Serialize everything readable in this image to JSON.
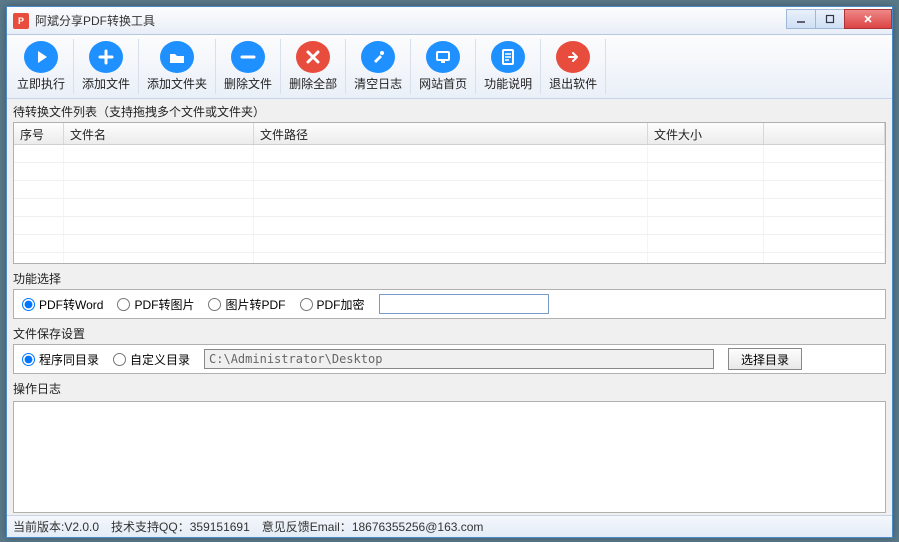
{
  "window": {
    "title": "阿斌分享PDF转换工具"
  },
  "toolbar": [
    {
      "id": "run",
      "label": "立即执行",
      "color": "#1e90ff",
      "icon": "play"
    },
    {
      "id": "add-file",
      "label": "添加文件",
      "color": "#1e90ff",
      "icon": "plus"
    },
    {
      "id": "add-folder",
      "label": "添加文件夹",
      "color": "#1e90ff",
      "icon": "folder"
    },
    {
      "id": "remove-file",
      "label": "删除文件",
      "color": "#1e90ff",
      "icon": "minus"
    },
    {
      "id": "remove-all",
      "label": "删除全部",
      "color": "#e74c3c",
      "icon": "x"
    },
    {
      "id": "clear-log",
      "label": "清空日志",
      "color": "#1e90ff",
      "icon": "brush"
    },
    {
      "id": "website",
      "label": "网站首页",
      "color": "#1e90ff",
      "icon": "monitor"
    },
    {
      "id": "help",
      "label": "功能说明",
      "color": "#1e90ff",
      "icon": "doc"
    },
    {
      "id": "exit",
      "label": "退出软件",
      "color": "#e74c3c",
      "icon": "exit"
    }
  ],
  "file_list": {
    "group_label": "待转换文件列表（支持拖拽多个文件或文件夹）",
    "columns": {
      "index": "序号",
      "name": "文件名",
      "path": "文件路径",
      "size": "文件大小"
    },
    "col_widths": {
      "index": 50,
      "name": 190,
      "path": 394,
      "size": 116,
      "tail": 110
    },
    "rows": []
  },
  "function_select": {
    "label": "功能选择",
    "options": {
      "pdf2word": "PDF转Word",
      "pdf2img": "PDF转图片",
      "img2pdf": "图片转PDF",
      "encrypt": "PDF加密"
    },
    "selected": "pdf2word",
    "password": ""
  },
  "save_settings": {
    "label": "文件保存设置",
    "options": {
      "same_dir": "程序同目录",
      "custom_dir": "自定义目录"
    },
    "selected": "same_dir",
    "path": "C:\\Administrator\\Desktop",
    "choose_btn": "选择目录"
  },
  "log": {
    "label": "操作日志",
    "content": ""
  },
  "status": {
    "version_label": "当前版本:",
    "version": "V2.0.0",
    "qq_label": "技术支持QQ：",
    "qq": "359151691",
    "email_label": "意见反馈Email：",
    "email": "18676355256@163.com"
  }
}
